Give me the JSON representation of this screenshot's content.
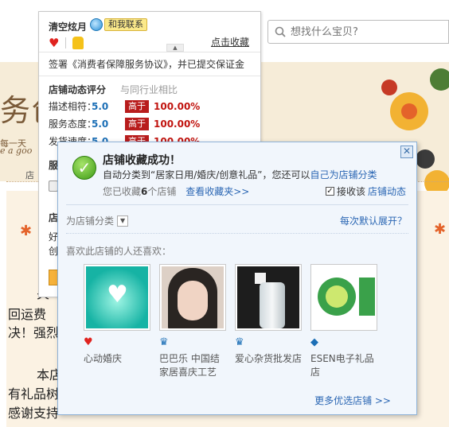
{
  "search": {
    "placeholder": "想找什么宝贝?"
  },
  "background": {
    "big_title": "务创",
    "sub_cn": "每一天",
    "sub_en": "e a goo",
    "shop_label": "店",
    "text_lines": [
      "关",
      "回运费",
      "决！强烈",
      "本店",
      "有礼品树",
      "感谢支持"
    ]
  },
  "seller": {
    "name": "清空炫月",
    "contact_label": "和我联系",
    "collect_label": "点击收藏",
    "agreement": "签署《消费者保障服务协议》，并已提交保证金",
    "rating_title": "店铺动态评分",
    "rating_compare": "与同行业相比",
    "ratings": [
      {
        "label": "描述相符：",
        "value": "5.0",
        "badge": "高于",
        "pct": "100.00%"
      },
      {
        "label": "服务态度：",
        "value": "5.0",
        "badge": "高于",
        "pct": "100.00%"
      },
      {
        "label": "发货速度：",
        "value": "5.0",
        "badge": "高于",
        "pct": "100.00%"
      }
    ],
    "cut_labels": [
      "服",
      "店",
      "好",
      "创"
    ]
  },
  "popup": {
    "title": "店铺收藏成功！",
    "desc_prefix": "自动分类到“居家日用/婚庆/创意礼品”，您还可以",
    "desc_link": "自己为店铺分类",
    "count_prefix": "您已收藏",
    "count_value": "6",
    "count_suffix": "个店铺",
    "view_link": "查看收藏夹>>",
    "receive_prefix": "接收该",
    "receive_link": "店铺动态",
    "category_label": "为店铺分类",
    "expand_link": "每次默认展开？",
    "also_like": "喜欢此店铺的人还喜欢：",
    "more_link": "更多优选店铺 >>",
    "shops": [
      {
        "name": "心动婚庆",
        "icon": "heart-badge-icon",
        "color": "#e0231f"
      },
      {
        "name": "巴巴乐 中国结家居喜庆工艺",
        "icon": "crown-badge-icon",
        "color": "#1c6fb6"
      },
      {
        "name": "爱心杂货批发店",
        "icon": "crown-badge-icon",
        "color": "#1c6fb6"
      },
      {
        "name": "ESEN电子礼品店",
        "icon": "diamond-badge-icon",
        "color": "#1c6fb6"
      }
    ]
  }
}
